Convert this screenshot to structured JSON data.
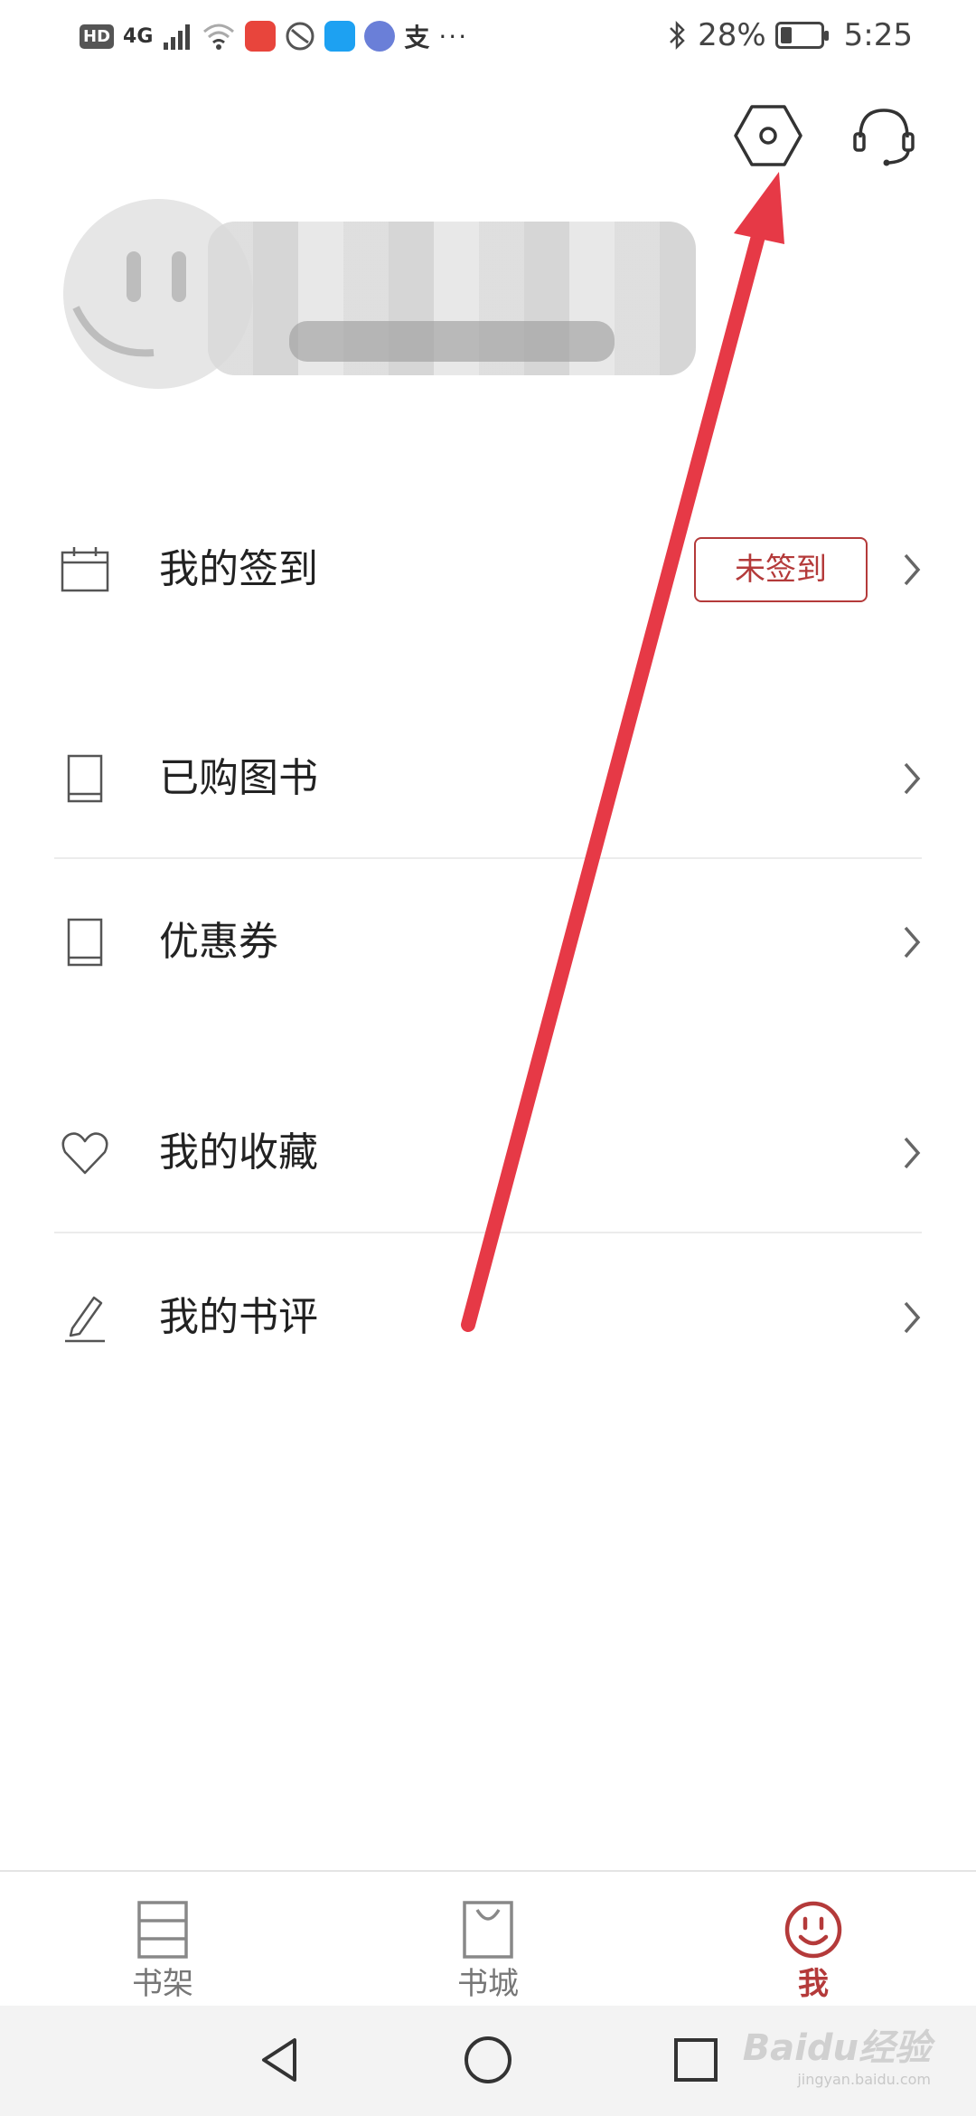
{
  "status_bar": {
    "hd": "HD",
    "network": "4G",
    "battery_text": "28%",
    "battery_level": 0.28,
    "time": "5:25",
    "more": "···",
    "alipay_glyph": "支"
  },
  "header": {
    "settings_icon": "settings-hexagon-icon",
    "service_icon": "headset-icon"
  },
  "menu": {
    "checkin": {
      "label": "我的签到",
      "button": "未签到"
    },
    "purchased": {
      "label": "已购图书"
    },
    "coupons": {
      "label": "优惠券"
    },
    "favorites": {
      "label": "我的收藏"
    },
    "reviews": {
      "label": "我的书评"
    }
  },
  "tabs": [
    {
      "label": "书架",
      "icon": "bookshelf-icon"
    },
    {
      "label": "书城",
      "icon": "store-bag-icon"
    },
    {
      "label": "我",
      "icon": "smiley-icon",
      "active": true
    }
  ],
  "watermark": {
    "brand": "Baidu经验",
    "url": "jingyan.baidu.com"
  },
  "colors": {
    "accent": "#b43a3a",
    "arrow": "#e63946"
  }
}
